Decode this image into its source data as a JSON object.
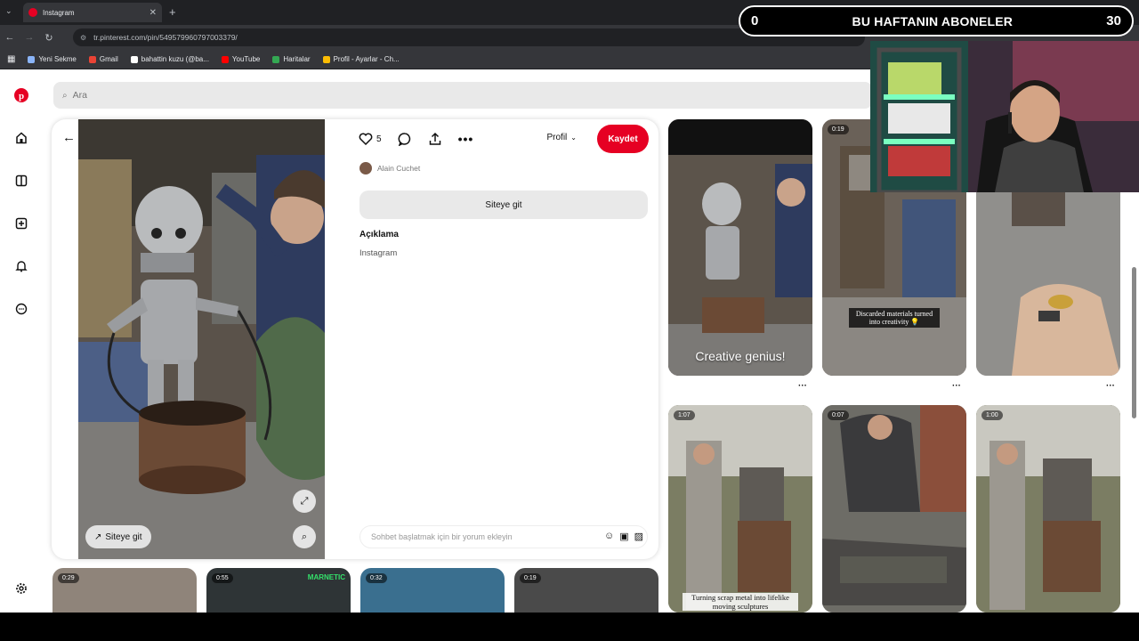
{
  "browser": {
    "tab_title": "Instagram",
    "url": "tr.pinterest.com/pin/549579960797003379/",
    "bookmarks": [
      {
        "label": "Yeni Sekme",
        "color": "#8ab4f8"
      },
      {
        "label": "Gmail",
        "color": "#ea4335"
      },
      {
        "label": "bahattin kuzu (@ba...",
        "color": "#ffffff"
      },
      {
        "label": "YouTube",
        "color": "#ff0000"
      },
      {
        "label": "Haritalar",
        "color": "#34a853"
      },
      {
        "label": "Profil - Ayarlar - Ch...",
        "color": "#fbbc04"
      }
    ]
  },
  "search": {
    "placeholder": "Ara"
  },
  "pin": {
    "likes": "5",
    "profile_label": "Profil",
    "save_label": "Kaydet",
    "author": "Alain Cuchet",
    "visit_label": "Siteye git",
    "image_visit_label": "Siteye git",
    "description_title": "Açıklama",
    "description_text": "Instagram",
    "comment_placeholder": "Sohbet başlatmak için bir yorum ekleyin"
  },
  "feed": [
    {
      "caption": "Creative genius!",
      "duration": ""
    },
    {
      "caption": "Discarded materials turned into creativity 💡",
      "duration": "0:19"
    },
    {
      "caption": "",
      "duration": ""
    },
    {
      "caption": "Turning scrap metal into lifelike moving sculptures",
      "duration": "1:07"
    },
    {
      "caption": "",
      "duration": "0:07"
    },
    {
      "caption": "",
      "duration": "1:00"
    }
  ],
  "bottom_row": [
    {
      "duration": "0:29"
    },
    {
      "duration": "0:55",
      "overlay": "MARNETIC"
    },
    {
      "duration": "0:32"
    },
    {
      "duration": "0:19"
    }
  ],
  "overlay": {
    "left_count": "0",
    "title": "BU HAFTANIN ABONELER",
    "right_count": "30"
  },
  "colors": {
    "brand": "#e60023"
  }
}
